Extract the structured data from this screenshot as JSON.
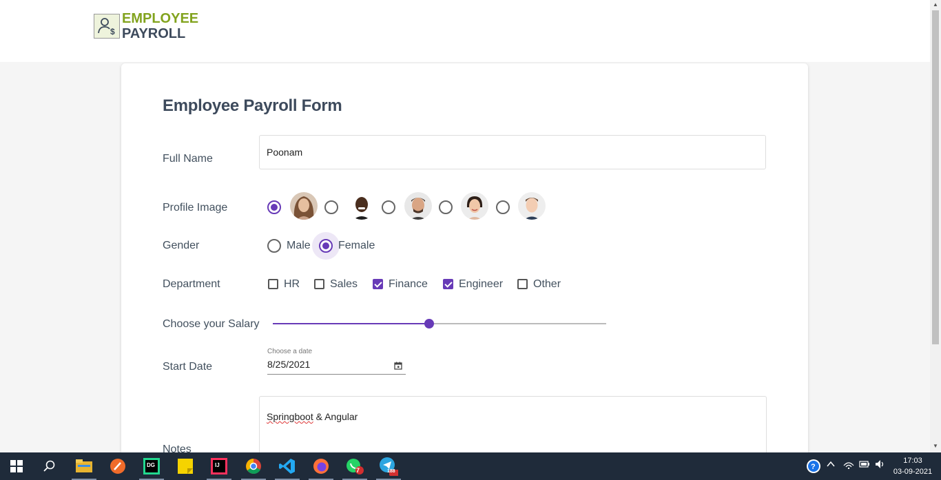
{
  "logo": {
    "line1": "EMPLOYEE",
    "line2": "PAYROLL"
  },
  "form": {
    "title": "Employee Payroll Form",
    "full_name": {
      "label": "Full Name",
      "value": "Poonam"
    },
    "profile_image": {
      "label": "Profile Image",
      "selected_index": 0,
      "options": [
        "avatar-1",
        "avatar-2",
        "avatar-3",
        "avatar-4",
        "avatar-5"
      ]
    },
    "gender": {
      "label": "Gender",
      "options": [
        "Male",
        "Female"
      ],
      "selected": "Female"
    },
    "department": {
      "label": "Department",
      "options": [
        {
          "label": "HR",
          "checked": false
        },
        {
          "label": "Sales",
          "checked": false
        },
        {
          "label": "Finance",
          "checked": true
        },
        {
          "label": "Engineer",
          "checked": true
        },
        {
          "label": "Other",
          "checked": false
        }
      ]
    },
    "salary": {
      "label": "Choose your Salary",
      "fraction": 0.47
    },
    "start_date": {
      "label": "Start Date",
      "hint": "Choose a date",
      "value": "8/25/2021"
    },
    "notes": {
      "label": "Notes",
      "value_word1": "Springboot",
      "value_rest": " & Angular"
    }
  },
  "taskbar": {
    "apps": [
      "windows-start",
      "search",
      "file-explorer",
      "app-orange",
      "datagrip",
      "sticky-notes",
      "intellij",
      "chrome-profile",
      "vscode",
      "firefox",
      "whatsapp",
      "telegram"
    ],
    "whatsapp_badge": "7",
    "telegram_badge": "188",
    "time": "17:03",
    "date": "03-09-2021"
  },
  "colors": {
    "accent": "#673ab7",
    "logo_green": "#82a31e",
    "logo_dark": "#3d4a5c"
  }
}
